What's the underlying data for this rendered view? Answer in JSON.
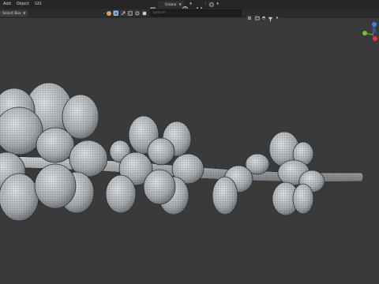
{
  "menu": {
    "items": [
      "Add",
      "Object",
      "GIS"
    ]
  },
  "header": {
    "transform_orientation": "Global"
  },
  "toolbar": {
    "select_mode": "Select Box"
  },
  "outliner": {
    "search_placeholder": "Search"
  },
  "colors": {
    "viewport_bg": "#3a3a3a",
    "header_bg": "#252525",
    "toolbar_bg": "#2b2b2b",
    "accent": "#4772b3",
    "gizmo_x": "#e0354d",
    "gizmo_y": "#7cbd3d",
    "gizmo_z": "#3f84e6"
  },
  "icons": [
    "arrow-select-icon",
    "transform-pivot-icon",
    "snap-icon",
    "proportional-edit-icon",
    "filter-icon",
    "visibility-icon",
    "view-gizmo"
  ]
}
